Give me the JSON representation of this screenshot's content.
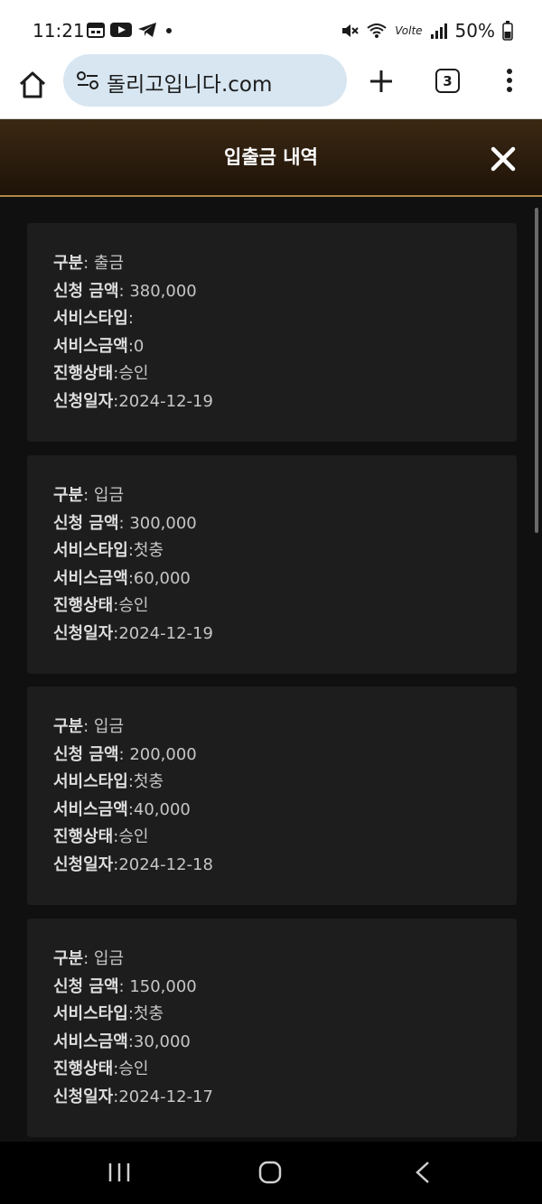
{
  "status_bar": {
    "time": "11:21",
    "battery": "50%",
    "left_icons": [
      "calendar-icon",
      "youtube-icon",
      "telegram-icon",
      "dot-icon"
    ],
    "right_icons": [
      "mute-icon",
      "wifi-icon",
      "volte-icon",
      "signal-icon",
      "battery-icon"
    ],
    "volte_label": "Volte"
  },
  "browser": {
    "url": "돌리고입니다.com",
    "tab_count": "3"
  },
  "modal": {
    "title": "입출금 내역",
    "labels": {
      "type": "구분",
      "amount": "신청 금액",
      "service_type": "서비스타입",
      "service_amount": "서비스금액",
      "status": "진행상태",
      "date": "신청일자"
    },
    "records": [
      {
        "type": "출금",
        "amount": "380,000",
        "service_type": "",
        "service_amount": "0",
        "status": "승인",
        "date": "2024-12-19"
      },
      {
        "type": "입금",
        "amount": "300,000",
        "service_type": "첫충",
        "service_amount": "60,000",
        "status": "승인",
        "date": "2024-12-19"
      },
      {
        "type": "입금",
        "amount": "200,000",
        "service_type": "첫충",
        "service_amount": "40,000",
        "status": "승인",
        "date": "2024-12-18"
      },
      {
        "type": "입금",
        "amount": "150,000",
        "service_type": "첫충",
        "service_amount": "30,000",
        "status": "승인",
        "date": "2024-12-17"
      }
    ]
  },
  "colors": {
    "header_gradient_top": "#3b2813",
    "header_gradient_bottom": "#1e1308",
    "header_border": "#b08648",
    "card_bg": "#1d1d1d",
    "page_bg": "#101010"
  }
}
